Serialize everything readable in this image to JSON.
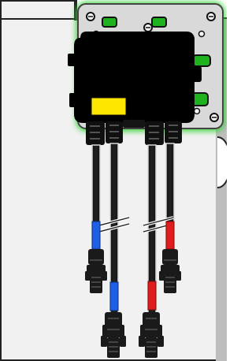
{
  "diagram": {
    "colors": {
      "background": "#ffffff",
      "panel_outline": "#222222",
      "panel_shadow": "#bdbdbd",
      "panel_face": "#f1f1f1",
      "bracket_plate": "#d9d9d9",
      "bracket_glow": "#2fd12f",
      "bracket_green": "#1fb21f",
      "housing": "#000000",
      "label_yellow": "#ffe600",
      "cable": "#111111",
      "cable_gray": "#d8d8d8",
      "cable_blue": "#1e5fe6",
      "cable_red": "#e11c1c",
      "connector": "#1a1a1a",
      "connector_highlight": "#6f6f6f"
    },
    "icons": {
      "screw": "screw-icon",
      "break": "cable-break-icon"
    },
    "labels": {
      "left_top": "",
      "left_bottom": "",
      "right_top": "",
      "right_bottom": ""
    }
  }
}
